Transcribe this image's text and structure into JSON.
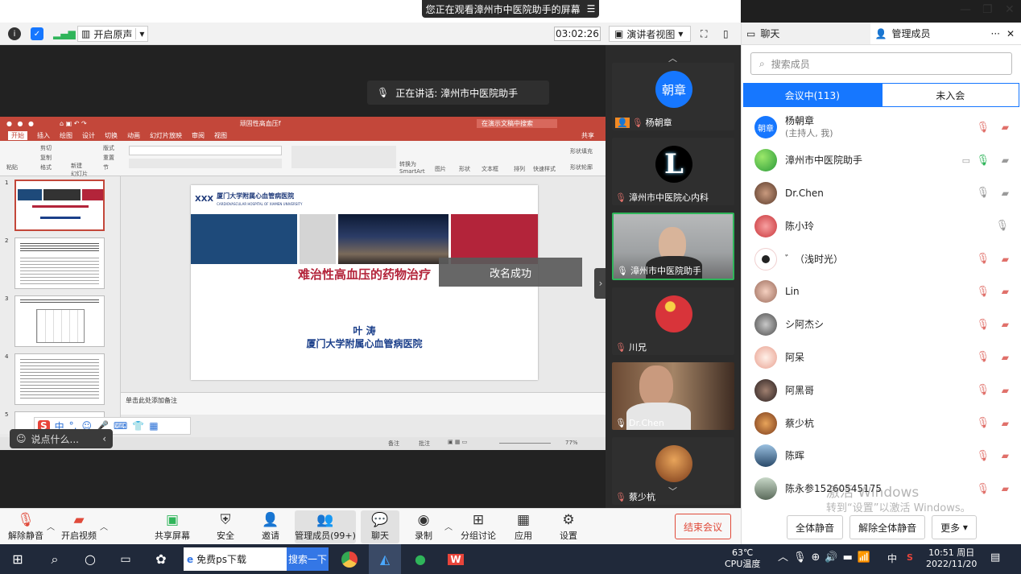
{
  "banner": {
    "text": "您正在观看漳州市中医院助手的屏幕",
    "icon": "menu-icon"
  },
  "window_controls": {
    "minimize": "—",
    "restore": "❐",
    "close": "✕"
  },
  "toolbar": {
    "original_sound": "开启原声",
    "timer": "03:02:26",
    "view_mode": "演讲者视图"
  },
  "speaking": {
    "label": "正在讲话: 漳州市中医院助手"
  },
  "ppt": {
    "window_title": "顽固性高血压f",
    "search_placeholder": "在演示文稿中搜索",
    "share_label": "共享",
    "tabs": [
      "开始",
      "插入",
      "绘图",
      "设计",
      "切换",
      "动画",
      "幻灯片放映",
      "审阅",
      "视图"
    ],
    "ribbon": {
      "paste": "粘贴",
      "cut": "剪切",
      "copy": "复制",
      "format": "格式",
      "new_slide": "新建\n幻灯片",
      "layout": "版式",
      "reset": "重置",
      "section": "节",
      "smartart": "转换为\nSmartArt",
      "image": "图片",
      "shape": "形状",
      "textbox": "文本框",
      "arrange": "排列",
      "quick_style": "快速样式",
      "shape_fill": "形状填充",
      "shape_outline": "形状轮廓"
    },
    "thumb_numbers": [
      "1",
      "2",
      "3",
      "4",
      "5"
    ],
    "slide": {
      "logo_text": "厦门大学附属心血管病医院",
      "logo_sub": "CARDIOVASCULAR HOSPITAL OF XIAMEN UNIVERSITY",
      "title": "难治性高血压的药物治疗",
      "author": "叶 涛",
      "org": "厦门大学附属心血管病医院"
    },
    "notes_placeholder": "单击此处添加备注",
    "status": {
      "notes": "备注",
      "comments": "批注",
      "zoom": "77%"
    }
  },
  "toast": "改名成功",
  "chat_input": {
    "placeholder": "说点什么..."
  },
  "ime": {
    "mode": "中",
    "punct": "°,"
  },
  "videos": [
    {
      "name": "杨朝章",
      "avatar_text": "朝章",
      "color": "#1677ff"
    },
    {
      "name": "漳州市中医院心内科",
      "avatar_text": "L",
      "color": "#000000"
    },
    {
      "name": "漳州市中医院助手",
      "avatar_text": "",
      "color": "#8a8f95"
    },
    {
      "name": "川兄",
      "avatar_text": "",
      "color": "#d8343a"
    },
    {
      "name": "Dr.Chen",
      "avatar_text": "",
      "color": "#5a4a40"
    },
    {
      "name": "蔡少杭",
      "avatar_text": "",
      "color": "#b86a2a"
    }
  ],
  "panel": {
    "tab_chat": "聊天",
    "tab_members": "管理成员",
    "more": "···",
    "close": "✕",
    "search_placeholder": "搜索成员",
    "seg_in": "会议中(113)",
    "seg_out": "未入会",
    "members": [
      {
        "name": "杨朝章",
        "sub": "(主持人, 我)",
        "avatar_text": "朝章",
        "color": "#1677ff"
      },
      {
        "name": "漳州市中医院助手",
        "sub": "",
        "avatar_text": "",
        "color": "#3cb54a"
      },
      {
        "name": "Dr.Chen",
        "sub": "",
        "avatar_text": "",
        "color": "#7a5a3a"
      },
      {
        "name": "陈小玲",
        "sub": "",
        "avatar_text": "",
        "color": "#d84a5a"
      },
      {
        "name": "゛（浅时光）",
        "sub": "",
        "avatar_text": "",
        "color": "#f5d6d6"
      },
      {
        "name": "Lin",
        "sub": "",
        "avatar_text": "",
        "color": "#e7b0a0"
      },
      {
        "name": "シ阿杰シ",
        "sub": "",
        "avatar_text": "",
        "color": "#8a8a8a"
      },
      {
        "name": "阿呆",
        "sub": "",
        "avatar_text": "",
        "color": "#f0c0b0"
      },
      {
        "name": "阿黑哥",
        "sub": "",
        "avatar_text": "",
        "color": "#5a4a4a"
      },
      {
        "name": "蔡少杭",
        "sub": "",
        "avatar_text": "",
        "color": "#b8763a"
      },
      {
        "name": "陈晖",
        "sub": "",
        "avatar_text": "",
        "color": "#3a6a8a"
      },
      {
        "name": "陈永参15260545175",
        "sub": "",
        "avatar_text": "",
        "color": "#7a8a7a"
      }
    ],
    "mute_all": "全体静音",
    "unmute_all": "解除全体静音",
    "more_btn": "更多"
  },
  "watermark": {
    "line1": "激活 Windows",
    "line2": "转到“设置”以激活 Windows。"
  },
  "bottom": {
    "unmute": "解除静音",
    "video": "开启视频",
    "share": "共享屏幕",
    "security": "安全",
    "invite": "邀请",
    "members": "管理成员(99+)",
    "chat": "聊天",
    "record": "录制",
    "breakout": "分组讨论",
    "apps": "应用",
    "settings": "设置",
    "end": "结束会议"
  },
  "taskbar": {
    "search_text": "免费ps下载",
    "search_btn": "搜索一下",
    "temp": "63℃",
    "cpu": "CPU温度",
    "ime": "中",
    "time": "10:51 周日",
    "date": "2022/11/20"
  }
}
